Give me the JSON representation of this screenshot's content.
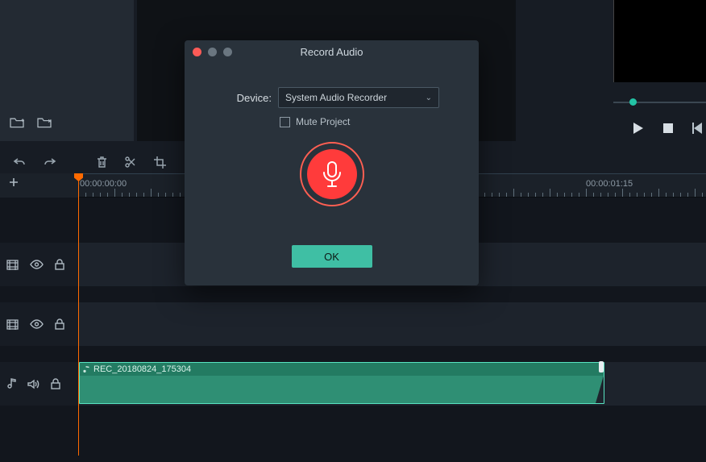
{
  "modal": {
    "title": "Record Audio",
    "device_label": "Device:",
    "device_value": "System Audio Recorder",
    "mute_label": "Mute Project",
    "ok_label": "OK"
  },
  "timeline": {
    "t0": "00:00:00:00",
    "t1": "00:00:01:15"
  },
  "clip": {
    "name": "REC_20180824_175304"
  },
  "colors": {
    "accent": "#3fbfa4",
    "record": "#ff3b3b",
    "playhead": "#ff6a00"
  }
}
